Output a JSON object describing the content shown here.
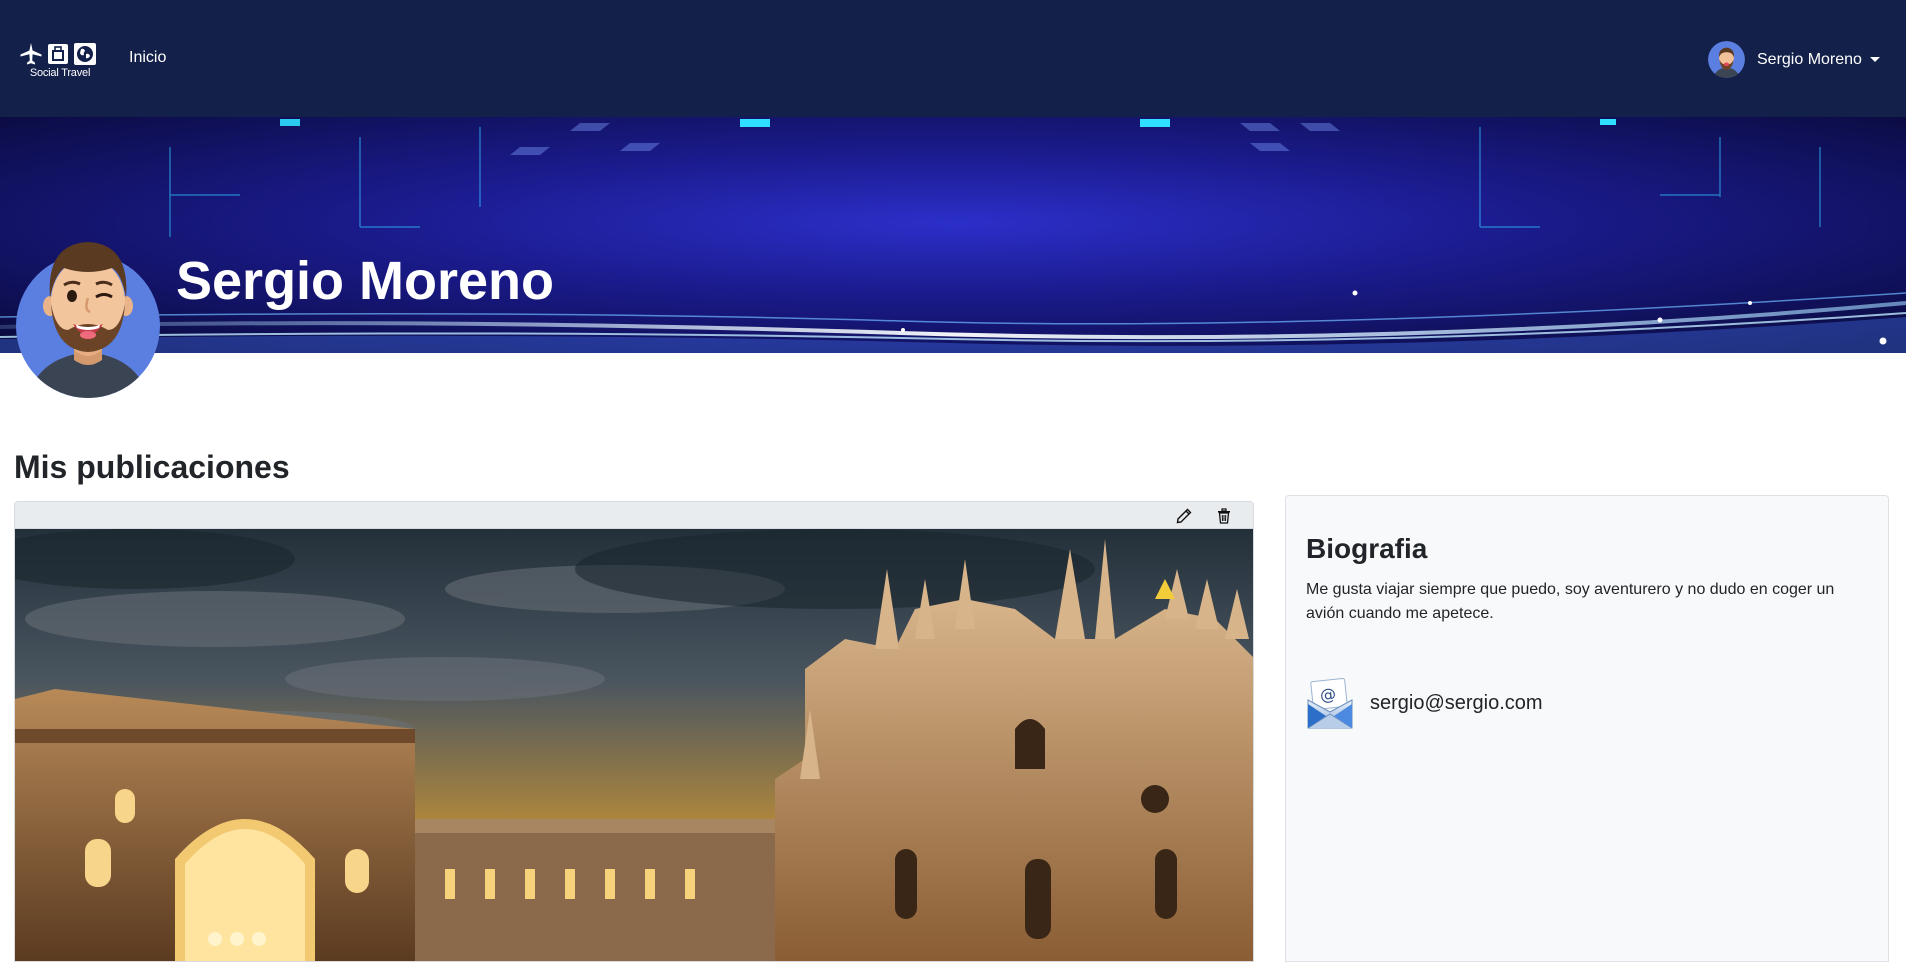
{
  "navbar": {
    "brand_text": "Social Travel",
    "brand_icons": [
      "airplane-icon",
      "luggage-icon",
      "globe-icon"
    ],
    "home_link": "Inicio",
    "user_name": "Sergio Moreno",
    "background": "#13204a"
  },
  "profile": {
    "name": "Sergio Moreno",
    "avatar_background": "#5b7fe0"
  },
  "main": {
    "section_title": "Mis publicaciones",
    "post": {
      "toolbar_icons": [
        "edit-icon",
        "trash-icon"
      ],
      "image_subject": "milan-cathedral-photo"
    }
  },
  "bio": {
    "title": "Biografia",
    "text": "Me gusta viajar siempre que puedo, soy aventurero y no dudo en coger un avión cuando me apetece.",
    "email": "sergio@sergio.com",
    "email_icon": "envelope-icon"
  }
}
